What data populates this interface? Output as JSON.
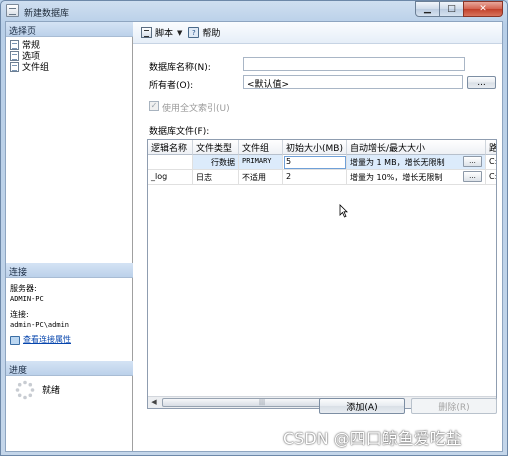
{
  "window": {
    "title": "新建数据库"
  },
  "left": {
    "select_page_header": "选择页",
    "pages": [
      {
        "label": "常规"
      },
      {
        "label": "选项"
      },
      {
        "label": "文件组"
      }
    ],
    "connection_header": "连接",
    "server_label": "服务器:",
    "server_value": "ADMIN-PC",
    "connection_label": "连接:",
    "connection_value": "admin-PC\\admin",
    "view_connection_link": "查看连接属性",
    "progress_header": "进度",
    "status": "就绪"
  },
  "toolbar": {
    "script_label": "脚本",
    "help_label": "帮助"
  },
  "form": {
    "db_name_label": "数据库名称(N):",
    "db_name_value": "",
    "owner_label": "所有者(O):",
    "owner_value": "<默认值>",
    "browse_label": "...",
    "fulltext_label": "使用全文索引(U)",
    "fulltext_checked": true,
    "db_files_label": "数据库文件(F):"
  },
  "grid": {
    "columns": [
      "逻辑名称",
      "文件类型",
      "文件组",
      "初始大小(MB)",
      "自动增长/最大大小",
      "路"
    ],
    "rows": [
      {
        "logical": "",
        "type": "行数据",
        "filegroup": "PRIMARY",
        "size": "5",
        "growth": "增量为 1 MB，增长无限制",
        "path_btn": "...",
        "path": "C:"
      },
      {
        "logical": "_log",
        "type": "日志",
        "filegroup": "不适用",
        "size": "2",
        "growth": "增量为 10%，增长无限制",
        "path_btn": "...",
        "path": "C:"
      }
    ]
  },
  "buttons": {
    "add": "添加(A)",
    "remove": "删除(R)"
  },
  "watermark": "CSDN @四口鲸鱼爱吃盐",
  "colors": {
    "accent": "#bcd1ea",
    "link": "#0645ad",
    "selection": "#dcebfb"
  },
  "icons": {
    "script": "script-icon",
    "help": "help-icon",
    "page": "page-icon",
    "connection": "connection-icon",
    "spinner": "spinner-icon"
  }
}
